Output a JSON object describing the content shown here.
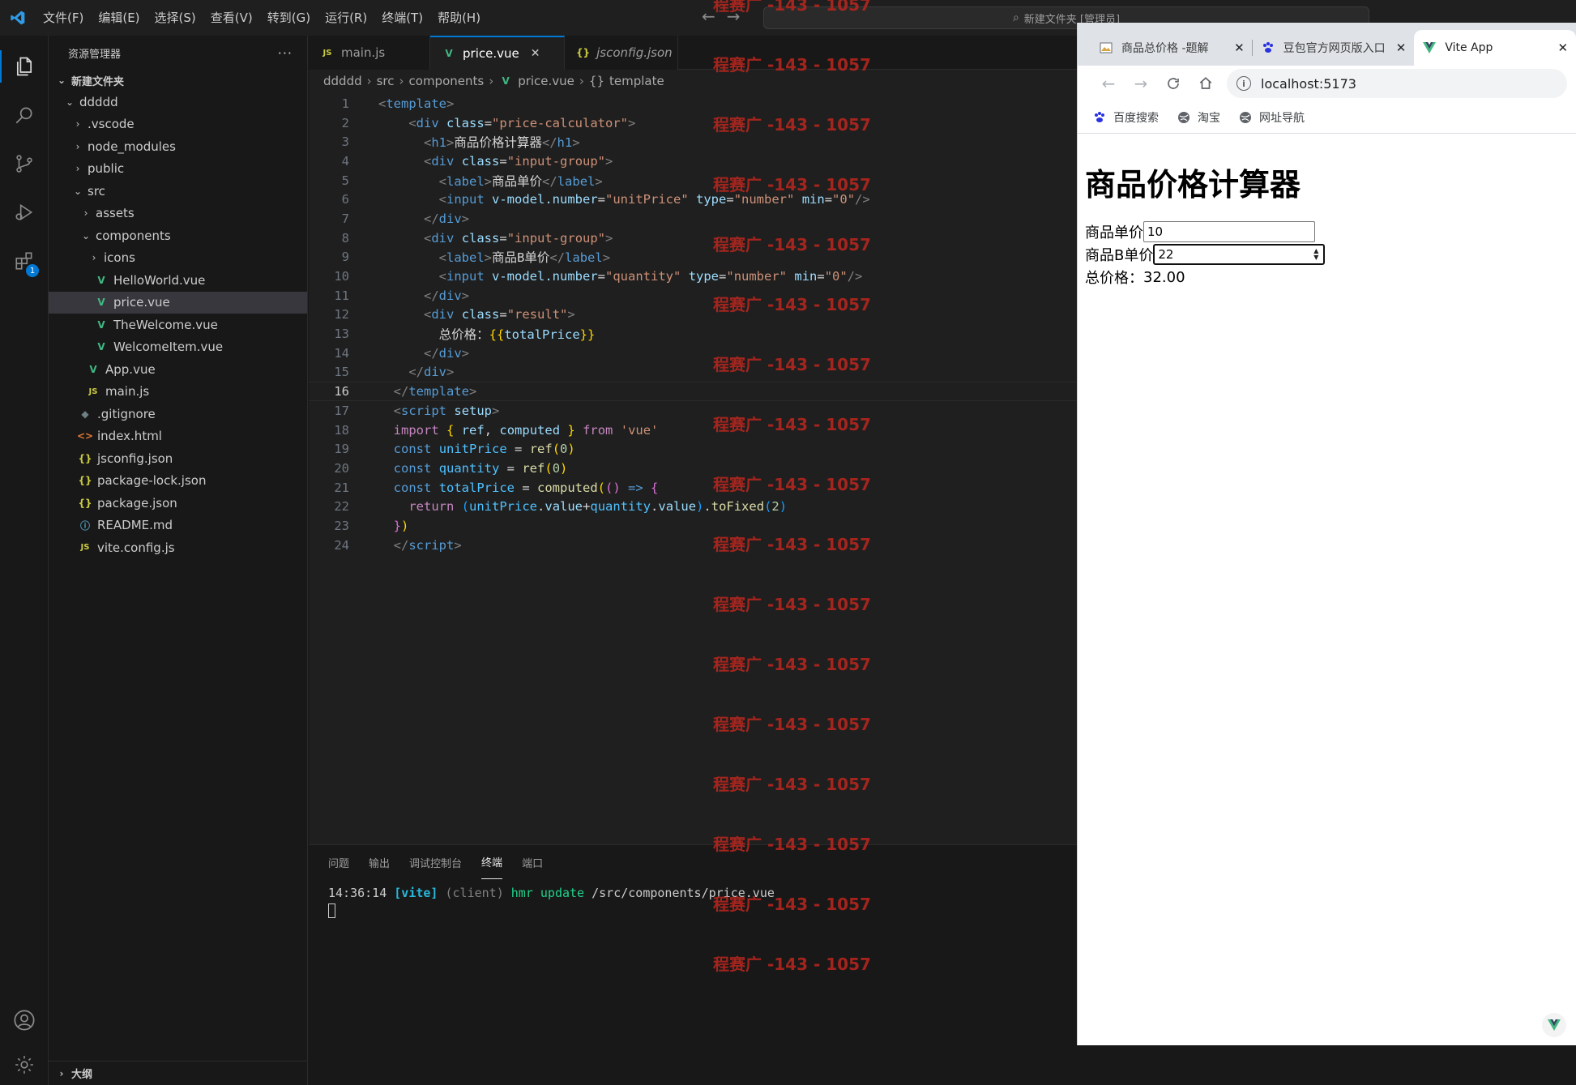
{
  "titlebar": {
    "menus": [
      "文件(F)",
      "编辑(E)",
      "选择(S)",
      "查看(V)",
      "转到(G)",
      "运行(R)",
      "终端(T)",
      "帮助(H)"
    ],
    "command_center": "新建文件夹 [管理员]"
  },
  "activity": {
    "extensions_badge": "1"
  },
  "sidebar": {
    "title": "资源管理器",
    "more": "···",
    "root": "新建文件夹",
    "tree": [
      {
        "label": "ddddd",
        "type": "folder-open",
        "indent": 0
      },
      {
        "label": ".vscode",
        "type": "folder",
        "indent": 1
      },
      {
        "label": "node_modules",
        "type": "folder",
        "indent": 1
      },
      {
        "label": "public",
        "type": "folder",
        "indent": 1
      },
      {
        "label": "src",
        "type": "folder-open",
        "indent": 1
      },
      {
        "label": "assets",
        "type": "folder",
        "indent": 2
      },
      {
        "label": "components",
        "type": "folder-open",
        "indent": 2
      },
      {
        "label": "icons",
        "type": "folder",
        "indent": 3
      },
      {
        "label": "HelloWorld.vue",
        "type": "vue",
        "indent": 3
      },
      {
        "label": "price.vue",
        "type": "vue",
        "indent": 3,
        "selected": true
      },
      {
        "label": "TheWelcome.vue",
        "type": "vue",
        "indent": 3
      },
      {
        "label": "WelcomeItem.vue",
        "type": "vue",
        "indent": 3
      },
      {
        "label": "App.vue",
        "type": "vue",
        "indent": 2
      },
      {
        "label": "main.js",
        "type": "js",
        "indent": 2
      },
      {
        "label": ".gitignore",
        "type": "git",
        "indent": 1
      },
      {
        "label": "index.html",
        "type": "html",
        "indent": 1
      },
      {
        "label": "jsconfig.json",
        "type": "json",
        "indent": 1
      },
      {
        "label": "package-lock.json",
        "type": "json",
        "indent": 1
      },
      {
        "label": "package.json",
        "type": "json",
        "indent": 1
      },
      {
        "label": "README.md",
        "type": "md",
        "indent": 1
      },
      {
        "label": "vite.config.js",
        "type": "js",
        "indent": 1
      }
    ],
    "outline": "大纲"
  },
  "editor": {
    "tabs": [
      {
        "label": "main.js",
        "type": "js",
        "active": false
      },
      {
        "label": "price.vue",
        "type": "vue",
        "active": true,
        "close": "✕"
      },
      {
        "label": "jsconfig.json",
        "type": "json",
        "active": false,
        "italic": true
      }
    ],
    "breadcrumb": [
      "ddddd",
      "src",
      "components",
      "price.vue",
      "template"
    ],
    "current_line": 16,
    "lines": [
      [
        [
          "t-br",
          "<"
        ],
        [
          "t-tag",
          "template"
        ],
        [
          "t-br",
          ">"
        ]
      ],
      [
        [
          "t-txt",
          "    "
        ],
        [
          "t-br",
          "<"
        ],
        [
          "t-tag",
          "div"
        ],
        [
          "t-txt",
          " "
        ],
        [
          "t-attr",
          "class"
        ],
        [
          "t-txt",
          "="
        ],
        [
          "t-str",
          "\"price-calculator\""
        ],
        [
          "t-br",
          ">"
        ]
      ],
      [
        [
          "t-txt",
          "      "
        ],
        [
          "t-br",
          "<"
        ],
        [
          "t-tag",
          "h1"
        ],
        [
          "t-br",
          ">"
        ],
        [
          "t-txt",
          "商品价格计算器"
        ],
        [
          "t-br",
          "</"
        ],
        [
          "t-tag",
          "h1"
        ],
        [
          "t-br",
          ">"
        ]
      ],
      [
        [
          "t-txt",
          "      "
        ],
        [
          "t-br",
          "<"
        ],
        [
          "t-tag",
          "div"
        ],
        [
          "t-txt",
          " "
        ],
        [
          "t-attr",
          "class"
        ],
        [
          "t-txt",
          "="
        ],
        [
          "t-str",
          "\"input-group\""
        ],
        [
          "t-br",
          ">"
        ]
      ],
      [
        [
          "t-txt",
          "        "
        ],
        [
          "t-br",
          "<"
        ],
        [
          "t-tag",
          "label"
        ],
        [
          "t-br",
          ">"
        ],
        [
          "t-txt",
          "商品单价"
        ],
        [
          "t-br",
          "</"
        ],
        [
          "t-tag",
          "label"
        ],
        [
          "t-br",
          ">"
        ]
      ],
      [
        [
          "t-txt",
          "        "
        ],
        [
          "t-br",
          "<"
        ],
        [
          "t-tag",
          "input"
        ],
        [
          "t-txt",
          " "
        ],
        [
          "t-attr",
          "v-model.number"
        ],
        [
          "t-txt",
          "="
        ],
        [
          "t-str",
          "\"unitPrice\""
        ],
        [
          "t-txt",
          " "
        ],
        [
          "t-attr",
          "type"
        ],
        [
          "t-txt",
          "="
        ],
        [
          "t-str",
          "\"number\""
        ],
        [
          "t-txt",
          " "
        ],
        [
          "t-attr",
          "min"
        ],
        [
          "t-txt",
          "="
        ],
        [
          "t-str",
          "\"0\""
        ],
        [
          "t-br",
          "/>"
        ]
      ],
      [
        [
          "t-txt",
          "      "
        ],
        [
          "t-br",
          "</"
        ],
        [
          "t-tag",
          "div"
        ],
        [
          "t-br",
          ">"
        ]
      ],
      [
        [
          "t-txt",
          "      "
        ],
        [
          "t-br",
          "<"
        ],
        [
          "t-tag",
          "div"
        ],
        [
          "t-txt",
          " "
        ],
        [
          "t-attr",
          "class"
        ],
        [
          "t-txt",
          "="
        ],
        [
          "t-str",
          "\"input-group\""
        ],
        [
          "t-br",
          ">"
        ]
      ],
      [
        [
          "t-txt",
          "        "
        ],
        [
          "t-br",
          "<"
        ],
        [
          "t-tag",
          "label"
        ],
        [
          "t-br",
          ">"
        ],
        [
          "t-txt",
          "商品B单价"
        ],
        [
          "t-br",
          "</"
        ],
        [
          "t-tag",
          "label"
        ],
        [
          "t-br",
          ">"
        ]
      ],
      [
        [
          "t-txt",
          "        "
        ],
        [
          "t-br",
          "<"
        ],
        [
          "t-tag",
          "input"
        ],
        [
          "t-txt",
          " "
        ],
        [
          "t-attr",
          "v-model.number"
        ],
        [
          "t-txt",
          "="
        ],
        [
          "t-str",
          "\"quantity\""
        ],
        [
          "t-txt",
          " "
        ],
        [
          "t-attr",
          "type"
        ],
        [
          "t-txt",
          "="
        ],
        [
          "t-str",
          "\"number\""
        ],
        [
          "t-txt",
          " "
        ],
        [
          "t-attr",
          "min"
        ],
        [
          "t-txt",
          "="
        ],
        [
          "t-str",
          "\"0\""
        ],
        [
          "t-br",
          "/>"
        ]
      ],
      [
        [
          "t-txt",
          "      "
        ],
        [
          "t-br",
          "</"
        ],
        [
          "t-tag",
          "div"
        ],
        [
          "t-br",
          ">"
        ]
      ],
      [
        [
          "t-txt",
          "      "
        ],
        [
          "t-br",
          "<"
        ],
        [
          "t-tag",
          "div"
        ],
        [
          "t-txt",
          " "
        ],
        [
          "t-attr",
          "class"
        ],
        [
          "t-txt",
          "="
        ],
        [
          "t-str",
          "\"result\""
        ],
        [
          "t-br",
          ">"
        ]
      ],
      [
        [
          "t-txt",
          "        总价格："
        ],
        [
          "t-b1",
          "{{"
        ],
        [
          "t-prop",
          "totalPrice"
        ],
        [
          "t-b1",
          "}}"
        ]
      ],
      [
        [
          "t-txt",
          "      "
        ],
        [
          "t-br",
          "</"
        ],
        [
          "t-tag",
          "div"
        ],
        [
          "t-br",
          ">"
        ]
      ],
      [
        [
          "t-txt",
          "    "
        ],
        [
          "t-br",
          "</"
        ],
        [
          "t-tag",
          "div"
        ],
        [
          "t-br",
          ">"
        ]
      ],
      [
        [
          "t-txt",
          "  "
        ],
        [
          "t-br",
          "</"
        ],
        [
          "t-tag",
          "template"
        ],
        [
          "t-br",
          ">"
        ]
      ],
      [
        [
          "t-txt",
          "  "
        ],
        [
          "t-br",
          "<"
        ],
        [
          "t-tag",
          "script"
        ],
        [
          "t-txt",
          " "
        ],
        [
          "t-attr",
          "setup"
        ],
        [
          "t-br",
          ">"
        ]
      ],
      [
        [
          "t-txt",
          "  "
        ],
        [
          "t-kw",
          "import"
        ],
        [
          "t-txt",
          " "
        ],
        [
          "t-b1",
          "{"
        ],
        [
          "t-txt",
          " "
        ],
        [
          "t-prop",
          "ref"
        ],
        [
          "t-txt",
          ", "
        ],
        [
          "t-prop",
          "computed"
        ],
        [
          "t-txt",
          " "
        ],
        [
          "t-b1",
          "}"
        ],
        [
          "t-txt",
          " "
        ],
        [
          "t-kw",
          "from"
        ],
        [
          "t-txt",
          " "
        ],
        [
          "t-str",
          "'vue'"
        ]
      ],
      [
        [
          "t-txt",
          "  "
        ],
        [
          "t-decl",
          "const"
        ],
        [
          "t-txt",
          " "
        ],
        [
          "t-var",
          "unitPrice"
        ],
        [
          "t-txt",
          " = "
        ],
        [
          "t-fn",
          "ref"
        ],
        [
          "t-b1",
          "("
        ],
        [
          "t-num",
          "0"
        ],
        [
          "t-b1",
          ")"
        ]
      ],
      [
        [
          "t-txt",
          "  "
        ],
        [
          "t-decl",
          "const"
        ],
        [
          "t-txt",
          " "
        ],
        [
          "t-var",
          "quantity"
        ],
        [
          "t-txt",
          " = "
        ],
        [
          "t-fn",
          "ref"
        ],
        [
          "t-b1",
          "("
        ],
        [
          "t-num",
          "0"
        ],
        [
          "t-b1",
          ")"
        ]
      ],
      [
        [
          "t-txt",
          "  "
        ],
        [
          "t-decl",
          "const"
        ],
        [
          "t-txt",
          " "
        ],
        [
          "t-var",
          "totalPrice"
        ],
        [
          "t-txt",
          " = "
        ],
        [
          "t-fn",
          "computed"
        ],
        [
          "t-b1",
          "("
        ],
        [
          "t-b2",
          "()"
        ],
        [
          "t-txt",
          " "
        ],
        [
          "t-decl",
          "=>"
        ],
        [
          "t-txt",
          " "
        ],
        [
          "t-b2",
          "{"
        ]
      ],
      [
        [
          "t-txt",
          "    "
        ],
        [
          "t-kw",
          "return"
        ],
        [
          "t-txt",
          " "
        ],
        [
          "t-b3",
          "("
        ],
        [
          "t-var",
          "unitPrice"
        ],
        [
          "t-txt",
          "."
        ],
        [
          "t-prop",
          "value"
        ],
        [
          "t-txt",
          "+"
        ],
        [
          "t-var",
          "quantity"
        ],
        [
          "t-txt",
          "."
        ],
        [
          "t-prop",
          "value"
        ],
        [
          "t-b3",
          ")"
        ],
        [
          "t-txt",
          "."
        ],
        [
          "t-fn",
          "toFixed"
        ],
        [
          "t-b3",
          "("
        ],
        [
          "t-num",
          "2"
        ],
        [
          "t-b3",
          ")"
        ]
      ],
      [
        [
          "t-txt",
          "  "
        ],
        [
          "t-b2",
          "}"
        ],
        [
          "t-b1",
          ")"
        ]
      ],
      [
        [
          "t-txt",
          "  "
        ],
        [
          "t-br",
          "</"
        ],
        [
          "t-tag",
          "script"
        ],
        [
          "t-br",
          ">"
        ]
      ]
    ]
  },
  "panel": {
    "tabs": [
      "问题",
      "输出",
      "调试控制台",
      "终端",
      "端口"
    ],
    "active_tab": "终端",
    "terminal": {
      "time": "14:36:14",
      "tag": "[vite]",
      "client": "(client)",
      "hmr": "hmr update",
      "path": "/src/components/price.vue"
    }
  },
  "watermark": "程赛广 -143 - 1057",
  "browser": {
    "tabs": [
      {
        "title": "商品总价格 -题解",
        "icon": "image-favicon"
      },
      {
        "title": "豆包官方网页版入口",
        "icon": "paw-favicon"
      },
      {
        "title": "Vite App",
        "icon": "vue-favicon",
        "active": true
      }
    ],
    "address": "localhost:5173",
    "bookmarks": [
      "百度搜索",
      "淘宝",
      "网址导航"
    ],
    "page": {
      "heading": "商品价格计算器",
      "label1": "商品单价",
      "value1": "10",
      "label2": "商品B单价",
      "value2": "22",
      "result_label": "总价格：",
      "result_value": "32.00"
    }
  }
}
